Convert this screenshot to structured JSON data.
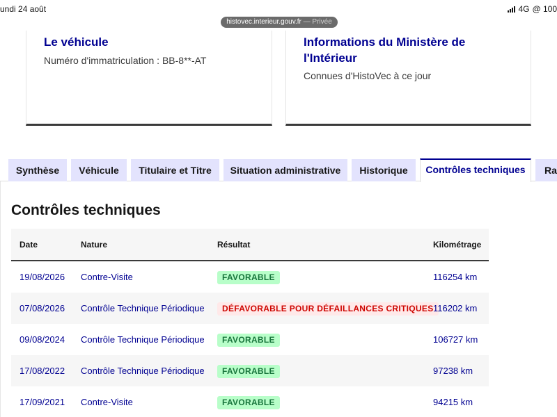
{
  "status_bar": {
    "date": "undi 24 août",
    "network": "4G",
    "battery": "@ 100"
  },
  "browser": {
    "domain": "histovec.interieur.gouv.fr",
    "mode": "— Privée"
  },
  "cards": [
    {
      "title": "Le véhicule",
      "text": "Numéro d'immatriculation : BB-8**-AT"
    },
    {
      "title": "Informations du Ministère de l'Intérieur",
      "text": "Connues d'HistoVec à ce jour"
    }
  ],
  "tabs": [
    {
      "label": "Synthèse",
      "active": false
    },
    {
      "label": "Véhicule",
      "active": false
    },
    {
      "label": "Titulaire et Titre",
      "active": false
    },
    {
      "label": "Situation administrative",
      "active": false
    },
    {
      "label": "Historique",
      "active": false
    },
    {
      "label": "Contrôles techniques",
      "active": true
    },
    {
      "label": "Rap",
      "active": false
    }
  ],
  "section_title": "Contrôles techniques",
  "table": {
    "headers": [
      "Date",
      "Nature",
      "Résultat",
      "Kilométrage"
    ],
    "rows": [
      {
        "date": "19/08/2026",
        "nature": "Contre-Visite",
        "result": "FAVORABLE",
        "status": "ok",
        "km": "116254 km"
      },
      {
        "date": "07/08/2026",
        "nature": "Contrôle Technique Périodique",
        "result": "DÉFAVORABLE POUR DÉFAILLANCES CRITIQUES",
        "status": "ko",
        "km": "116202 km"
      },
      {
        "date": "09/08/2024",
        "nature": "Contrôle Technique Périodique",
        "result": "FAVORABLE",
        "status": "ok",
        "km": "106727 km"
      },
      {
        "date": "17/08/2022",
        "nature": "Contrôle Technique Périodique",
        "result": "FAVORABLE",
        "status": "ok",
        "km": "97238 km"
      },
      {
        "date": "17/09/2021",
        "nature": "Contre-Visite",
        "result": "FAVORABLE",
        "status": "ok",
        "km": "94215 km"
      }
    ]
  },
  "colors": {
    "primary": "#000091",
    "tab_bg": "#e3e3fd",
    "ok_bg": "#b8fec9",
    "ok_text": "#18753c",
    "ko_bg": "#ffe9e9",
    "ko_text": "#ce0500"
  }
}
